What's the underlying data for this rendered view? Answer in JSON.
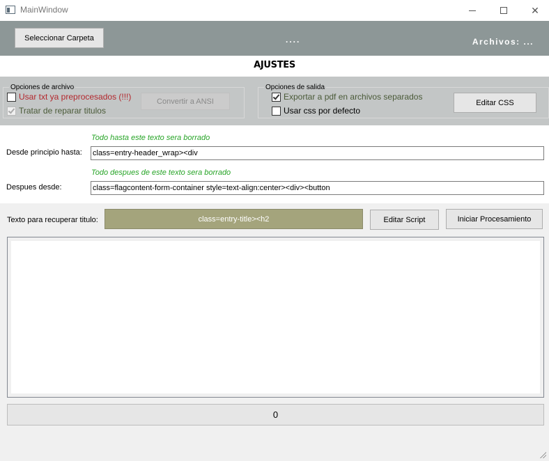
{
  "window": {
    "title": "MainWindow",
    "icon": "app-window-icon",
    "controls": {
      "minimize": "minimize-icon",
      "maximize": "maximize-icon",
      "close": "close-icon"
    }
  },
  "topbar": {
    "select_folder_label": "Seleccionar Carpeta",
    "folder_path": "....",
    "files_label": "Archivos: ...",
    "background": "#8d9797"
  },
  "section_title": "AJUSTES",
  "file_options": {
    "legend": "Opciones de archivo",
    "use_preprocessed": {
      "label": "Usar txt ya preprocesados (!!!)",
      "checked": false,
      "color": "#b3272d"
    },
    "repair_titles": {
      "label": "Tratar de reparar titulos",
      "checked": true,
      "enabled": false
    },
    "convert_ansi_label": "Convertir a ANSI"
  },
  "output_options": {
    "legend": "Opciones de salida",
    "export_separate_pdf": {
      "label": "Exportar a pdf en archivos separados",
      "checked": true
    },
    "default_css": {
      "label": "Usar css por defecto",
      "checked": false
    },
    "edit_css_label": "Editar CSS"
  },
  "trim": {
    "start_hint": "Todo hasta este texto sera borrado",
    "start_label": "Desde principio hasta:",
    "start_value": "class=entry-header_wrap><div",
    "end_hint": "Todo despues de este texto sera borrado",
    "end_label": "Despues desde:",
    "end_value": "class=flagcontent-form-container style=text-align:center><div><button",
    "hint_color": "#27a427"
  },
  "title_extract": {
    "label": "Texto para recuperar titulo:",
    "value": "class=entry-title><h2",
    "field_color": "#a4a47c",
    "edit_script_label": "Editar Script",
    "start_processing_label": "Iniciar Procesamiento"
  },
  "log": {
    "text": ""
  },
  "progress": {
    "count": "0"
  }
}
